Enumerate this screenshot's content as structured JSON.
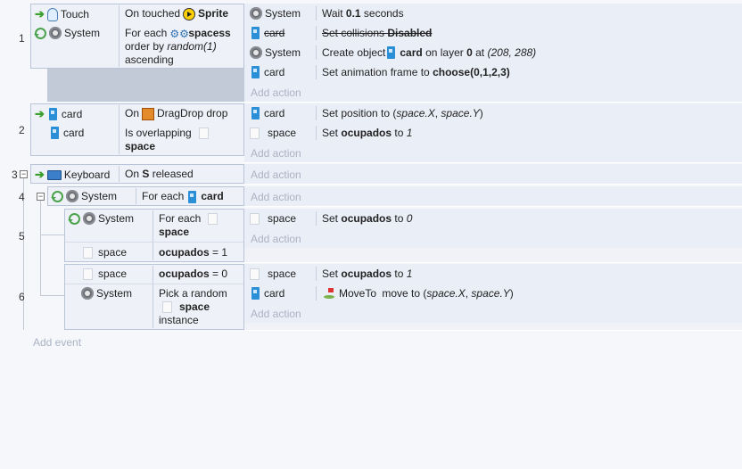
{
  "events": [
    {
      "number": "1",
      "conditions": [
        {
          "object": "Touch",
          "icon": "touch-icon",
          "text_parts": [
            "On touched ",
            "",
            "Sprite"
          ]
        },
        {
          "object": "System",
          "icon": "system-icon",
          "text": "For each",
          "obj": "spacess",
          "line2": "order by ",
          "func": "random(1)",
          "line3": "ascending"
        }
      ],
      "actions": [
        {
          "object": "System",
          "text": "Wait ",
          "bold": "0.1",
          "rest": " seconds"
        },
        {
          "object": "card",
          "disabled": true,
          "text": "Set collisions ",
          "bold": "Disabled"
        },
        {
          "object": "System",
          "text": "Create object ",
          "obj": "card",
          "mid": " on layer ",
          "bold": "0",
          "rest": " at ",
          "ital": "(208, 288)"
        },
        {
          "object": "card",
          "text": "Set animation frame to ",
          "bold": "choose(0,1,2,3)"
        }
      ],
      "add_action": "Add action"
    },
    {
      "number": "2",
      "conditions": [
        {
          "object": "card",
          "text_a": "On ",
          "drag_text": "DragDrop drop"
        },
        {
          "object": "card",
          "line1": "Is overlapping",
          "line2": "space"
        }
      ],
      "actions": [
        {
          "object": "card",
          "text": "Set position to (",
          "ital": "space.X",
          "mid": ", ",
          "ital2": "space.Y",
          "rest": ")"
        },
        {
          "object": "space",
          "text": "Set ",
          "bold": "ocupados",
          "mid": " to ",
          "ital": "1"
        }
      ],
      "add_action": "Add action"
    },
    {
      "number": "3",
      "conditions": [
        {
          "object": "Keyboard",
          "text_a": "On ",
          "bold": "S",
          "rest": " released"
        }
      ],
      "add_action": "Add action"
    },
    {
      "number": "4",
      "conditions": [
        {
          "object": "System",
          "text": "For each",
          "obj": "card"
        }
      ],
      "add_action": "Add action"
    },
    {
      "number": "5",
      "conditions": [
        {
          "object": "System",
          "line1": "For each",
          "line2": "space"
        },
        {
          "object": "space",
          "bold": "ocupados",
          "rest": " = 1"
        }
      ],
      "actions": [
        {
          "object": "space",
          "text": "Set ",
          "bold": "ocupados",
          "mid": " to ",
          "ital": "0"
        }
      ],
      "add_action": "Add action"
    },
    {
      "number": "6",
      "conditions": [
        {
          "object": "space",
          "bold": "ocupados",
          "rest": " = 0"
        },
        {
          "object": "System",
          "line1": "Pick a random",
          "line2": "space",
          "line3": "instance"
        }
      ],
      "actions": [
        {
          "object": "space",
          "text": "Set ",
          "bold": "ocupados",
          "mid": " to ",
          "ital": "1"
        },
        {
          "object": "card",
          "behavior": "MoveTo",
          "text": " move to (",
          "ital": "space.X",
          "mid": ", ",
          "ital2": "space.Y",
          "rest": ")"
        }
      ],
      "add_action": "Add action"
    }
  ],
  "add_event": "Add event",
  "colors": {
    "background": "#f6f7fb",
    "condition_bg": "#eef1f8",
    "action_bg": "#eaeef7",
    "muted": "#aab3c3"
  }
}
